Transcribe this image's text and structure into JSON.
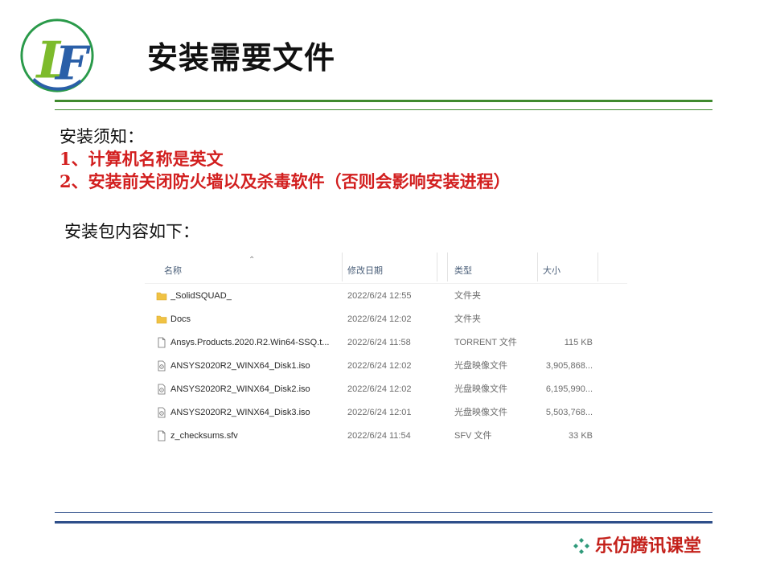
{
  "slide": {
    "title": "安装需要文件",
    "notice_heading": "安装须知：",
    "notice_items": [
      "1、计算机名称是英文",
      "2、安装前关闭防火墙以及杀毒软件（否则会影响安装进程）"
    ],
    "package_label": "安装包内容如下："
  },
  "explorer": {
    "columns": [
      "名称",
      "修改日期",
      "类型",
      "大小"
    ],
    "files": [
      {
        "name": "_SolidSQUAD_",
        "date": "2022/6/24 12:55",
        "type": "文件夹",
        "size": "",
        "icon": "folder-icon"
      },
      {
        "name": "Docs",
        "date": "2022/6/24 12:02",
        "type": "文件夹",
        "size": "",
        "icon": "folder-icon"
      },
      {
        "name": "Ansys.Products.2020.R2.Win64-SSQ.t...",
        "date": "2022/6/24 11:58",
        "type": "TORRENT 文件",
        "size": "115 KB",
        "icon": "file-icon"
      },
      {
        "name": "ANSYS2020R2_WINX64_Disk1.iso",
        "date": "2022/6/24 12:02",
        "type": "光盘映像文件",
        "size": "3,905,868...",
        "icon": "disc-image-icon"
      },
      {
        "name": "ANSYS2020R2_WINX64_Disk2.iso",
        "date": "2022/6/24 12:02",
        "type": "光盘映像文件",
        "size": "6,195,990...",
        "icon": "disc-image-icon"
      },
      {
        "name": "ANSYS2020R2_WINX64_Disk3.iso",
        "date": "2022/6/24 12:01",
        "type": "光盘映像文件",
        "size": "5,503,768...",
        "icon": "disc-image-icon"
      },
      {
        "name": "z_checksums.sfv",
        "date": "2022/6/24 11:54",
        "type": "SFV 文件",
        "size": "33 KB",
        "icon": "file-icon"
      }
    ]
  },
  "footer": {
    "brand": "乐仿腾讯课堂"
  },
  "colors": {
    "accent_green": "#3f8a2e",
    "accent_blue": "#2e4f8a",
    "notice_red": "#d21f1f",
    "brand_red": "#c4211b",
    "folder_yellow": "#f0c243"
  }
}
